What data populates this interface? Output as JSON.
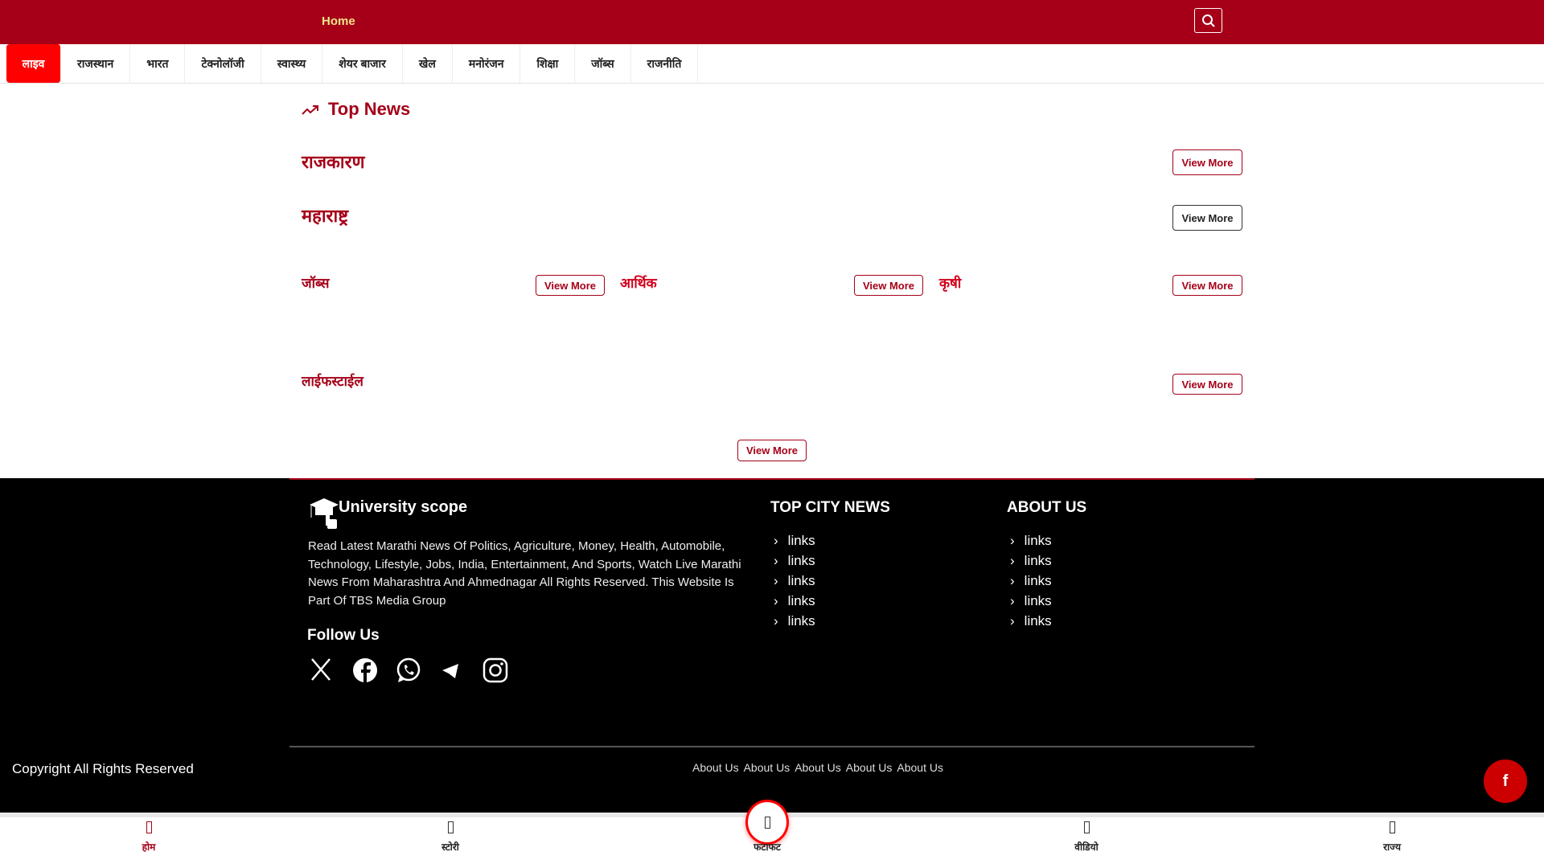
{
  "header": {
    "home_label": "Home",
    "search_icon": "search-icon"
  },
  "nav": [
    "लाइव",
    "राजस्थान",
    "भारत",
    "टेक्नोलॉजी",
    "स्वास्थ्य",
    "शेयर बाजार",
    "खेल",
    "मनोरंजन",
    "शिक्षा",
    "जॉब्स",
    "राजनीति"
  ],
  "main": {
    "title": "Top News",
    "view_more": "View More",
    "sections": [
      "राजकारण",
      "महाराष्ट्र"
    ],
    "columns": [
      "जॉब्स",
      "आर्थिक",
      "कृषी"
    ],
    "lifestyle": "लाईफस्टाईल"
  },
  "footer": {
    "brand": "University scope",
    "description": " Read Latest Marathi News Of Politics, Agriculture, Money, Health, Automobile, Technology, Lifestyle, Jobs, India, Entertainment, And Sports, Watch Live Marathi News From Maharashtra And Ahmednagar All Rights Reserved. This Website Is Part Of TBS Media Group",
    "follow_us": "Follow Us",
    "city_title": "TOP CITY NEWS",
    "about_title": "ABOUT US",
    "city_links": [
      "links",
      "links",
      "links",
      "links",
      "links"
    ],
    "about_links": [
      "links",
      "links",
      "links",
      "links",
      "links"
    ],
    "copyright": "Copyright All Rights Reserved",
    "bottom_links": [
      "About Us",
      "About Us",
      "About Us",
      "About Us",
      "About Us"
    ]
  },
  "bottom_nav": [
    "होम",
    "स्टोरी",
    "फटाफट",
    "वीडियो",
    "राज्य"
  ],
  "colors": {
    "brand": "#a50018",
    "accent": "#ff0000"
  }
}
